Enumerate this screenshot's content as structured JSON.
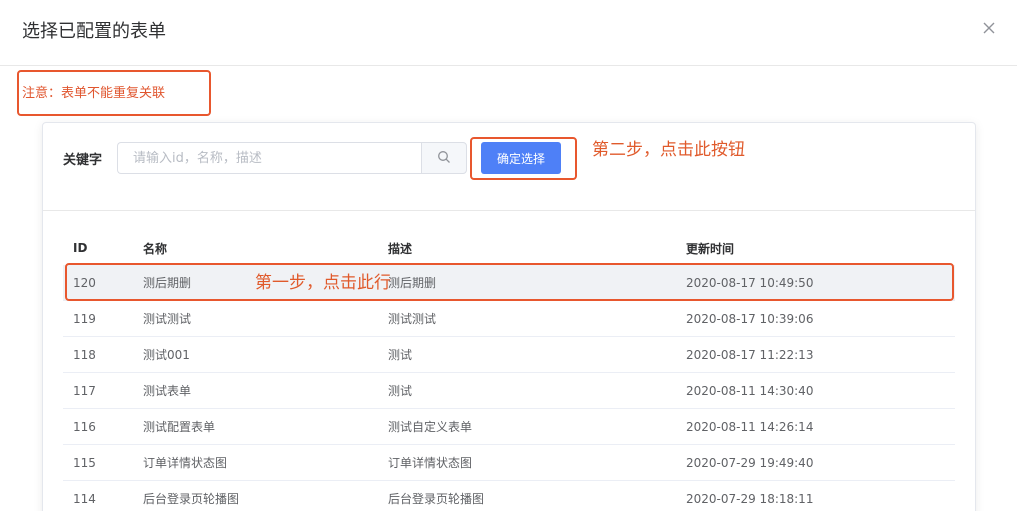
{
  "dialog": {
    "title": "选择已配置的表单",
    "close_icon": "close-icon"
  },
  "note": "注意：表单不能重复关联",
  "search": {
    "label": "关键字",
    "placeholder": "请输入id，名称，描述",
    "value": "",
    "search_icon": "search-icon"
  },
  "confirm_label": "确定选择",
  "annotations": {
    "step1": "第一步，点击此行",
    "step2": "第二步，点击此按钮",
    "color": "#e8572e"
  },
  "table": {
    "headers": {
      "id": "ID",
      "name": "名称",
      "desc": "描述",
      "time": "更新时间"
    },
    "rows": [
      {
        "id": "120",
        "name": "测后期删",
        "desc": "测后期删",
        "time": "2020-08-17 10:49:50"
      },
      {
        "id": "119",
        "name": "测试测试",
        "desc": "测试测试",
        "time": "2020-08-17 10:39:06"
      },
      {
        "id": "118",
        "name": "测试001",
        "desc": "测试",
        "time": "2020-08-17 11:22:13"
      },
      {
        "id": "117",
        "name": "测试表单",
        "desc": "测试",
        "time": "2020-08-11 14:30:40"
      },
      {
        "id": "116",
        "name": "测试配置表单",
        "desc": "测试自定义表单",
        "time": "2020-08-11 14:26:14"
      },
      {
        "id": "115",
        "name": "订单详情状态图",
        "desc": "订单详情状态图",
        "time": "2020-07-29 19:49:40"
      },
      {
        "id": "114",
        "name": "后台登录页轮播图",
        "desc": "后台登录页轮播图",
        "time": "2020-07-29 18:18:11"
      }
    ]
  },
  "colors": {
    "primary": "#4e80f7",
    "annotation": "#e8572e"
  }
}
